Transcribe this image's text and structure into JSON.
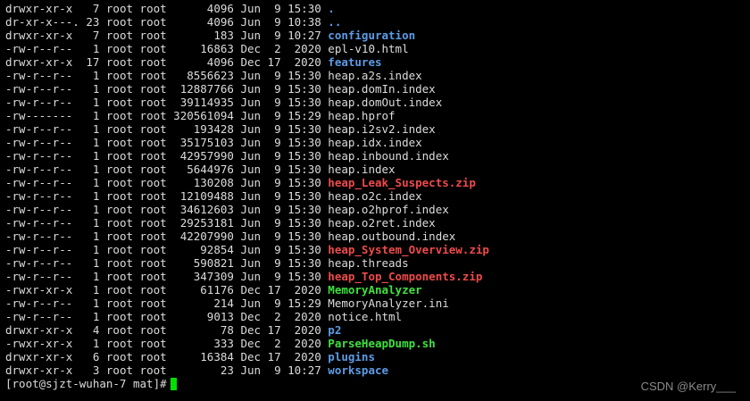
{
  "terminal": {
    "lines": [
      {
        "perms": "drwxr-xr-x",
        "links": "7",
        "owner": "root",
        "group": "root",
        "size": "4096",
        "month": "Jun",
        "day": "9",
        "time": "15:30",
        "name": ".",
        "kind": "dot"
      },
      {
        "perms": "dr-xr-x---.",
        "links": "23",
        "owner": "root",
        "group": "root",
        "size": "4096",
        "month": "Jun",
        "day": "9",
        "time": "10:38",
        "name": "..",
        "kind": "dot"
      },
      {
        "perms": "drwxr-xr-x",
        "links": "7",
        "owner": "root",
        "group": "root",
        "size": "183",
        "month": "Jun",
        "day": "9",
        "time": "10:27",
        "name": "configuration",
        "kind": "dir"
      },
      {
        "perms": "-rw-r--r--",
        "links": "1",
        "owner": "root",
        "group": "root",
        "size": "16863",
        "month": "Dec",
        "day": "2",
        "time": "2020",
        "name": "epl-v10.html",
        "kind": "plain"
      },
      {
        "perms": "drwxr-xr-x",
        "links": "17",
        "owner": "root",
        "group": "root",
        "size": "4096",
        "month": "Dec",
        "day": "17",
        "time": "2020",
        "name": "features",
        "kind": "dir"
      },
      {
        "perms": "-rw-r--r--",
        "links": "1",
        "owner": "root",
        "group": "root",
        "size": "8556623",
        "month": "Jun",
        "day": "9",
        "time": "15:30",
        "name": "heap.a2s.index",
        "kind": "plain"
      },
      {
        "perms": "-rw-r--r--",
        "links": "1",
        "owner": "root",
        "group": "root",
        "size": "12887766",
        "month": "Jun",
        "day": "9",
        "time": "15:30",
        "name": "heap.domIn.index",
        "kind": "plain"
      },
      {
        "perms": "-rw-r--r--",
        "links": "1",
        "owner": "root",
        "group": "root",
        "size": "39114935",
        "month": "Jun",
        "day": "9",
        "time": "15:30",
        "name": "heap.domOut.index",
        "kind": "plain"
      },
      {
        "perms": "-rw-------",
        "links": "1",
        "owner": "root",
        "group": "root",
        "size": "320561094",
        "month": "Jun",
        "day": "9",
        "time": "15:29",
        "name": "heap.hprof",
        "kind": "plain"
      },
      {
        "perms": "-rw-r--r--",
        "links": "1",
        "owner": "root",
        "group": "root",
        "size": "193428",
        "month": "Jun",
        "day": "9",
        "time": "15:30",
        "name": "heap.i2sv2.index",
        "kind": "plain"
      },
      {
        "perms": "-rw-r--r--",
        "links": "1",
        "owner": "root",
        "group": "root",
        "size": "35175103",
        "month": "Jun",
        "day": "9",
        "time": "15:30",
        "name": "heap.idx.index",
        "kind": "plain"
      },
      {
        "perms": "-rw-r--r--",
        "links": "1",
        "owner": "root",
        "group": "root",
        "size": "42957990",
        "month": "Jun",
        "day": "9",
        "time": "15:30",
        "name": "heap.inbound.index",
        "kind": "plain"
      },
      {
        "perms": "-rw-r--r--",
        "links": "1",
        "owner": "root",
        "group": "root",
        "size": "5644976",
        "month": "Jun",
        "day": "9",
        "time": "15:30",
        "name": "heap.index",
        "kind": "plain"
      },
      {
        "perms": "-rw-r--r--",
        "links": "1",
        "owner": "root",
        "group": "root",
        "size": "130208",
        "month": "Jun",
        "day": "9",
        "time": "15:30",
        "name": "heap_Leak_Suspects.zip",
        "kind": "archive"
      },
      {
        "perms": "-rw-r--r--",
        "links": "1",
        "owner": "root",
        "group": "root",
        "size": "12109488",
        "month": "Jun",
        "day": "9",
        "time": "15:30",
        "name": "heap.o2c.index",
        "kind": "plain"
      },
      {
        "perms": "-rw-r--r--",
        "links": "1",
        "owner": "root",
        "group": "root",
        "size": "34612603",
        "month": "Jun",
        "day": "9",
        "time": "15:30",
        "name": "heap.o2hprof.index",
        "kind": "plain"
      },
      {
        "perms": "-rw-r--r--",
        "links": "1",
        "owner": "root",
        "group": "root",
        "size": "29253181",
        "month": "Jun",
        "day": "9",
        "time": "15:30",
        "name": "heap.o2ret.index",
        "kind": "plain"
      },
      {
        "perms": "-rw-r--r--",
        "links": "1",
        "owner": "root",
        "group": "root",
        "size": "42207990",
        "month": "Jun",
        "day": "9",
        "time": "15:30",
        "name": "heap.outbound.index",
        "kind": "plain"
      },
      {
        "perms": "-rw-r--r--",
        "links": "1",
        "owner": "root",
        "group": "root",
        "size": "92854",
        "month": "Jun",
        "day": "9",
        "time": "15:30",
        "name": "heap_System_Overview.zip",
        "kind": "archive"
      },
      {
        "perms": "-rw-r--r--",
        "links": "1",
        "owner": "root",
        "group": "root",
        "size": "590821",
        "month": "Jun",
        "day": "9",
        "time": "15:30",
        "name": "heap.threads",
        "kind": "plain"
      },
      {
        "perms": "-rw-r--r--",
        "links": "1",
        "owner": "root",
        "group": "root",
        "size": "347309",
        "month": "Jun",
        "day": "9",
        "time": "15:30",
        "name": "heap_Top_Components.zip",
        "kind": "archive"
      },
      {
        "perms": "-rwxr-xr-x",
        "links": "1",
        "owner": "root",
        "group": "root",
        "size": "61176",
        "month": "Dec",
        "day": "17",
        "time": "2020",
        "name": "MemoryAnalyzer",
        "kind": "exec"
      },
      {
        "perms": "-rw-r--r--",
        "links": "1",
        "owner": "root",
        "group": "root",
        "size": "214",
        "month": "Jun",
        "day": "9",
        "time": "15:29",
        "name": "MemoryAnalyzer.ini",
        "kind": "plain"
      },
      {
        "perms": "-rw-r--r--",
        "links": "1",
        "owner": "root",
        "group": "root",
        "size": "9013",
        "month": "Dec",
        "day": "2",
        "time": "2020",
        "name": "notice.html",
        "kind": "plain"
      },
      {
        "perms": "drwxr-xr-x",
        "links": "4",
        "owner": "root",
        "group": "root",
        "size": "78",
        "month": "Dec",
        "day": "17",
        "time": "2020",
        "name": "p2",
        "kind": "dir"
      },
      {
        "perms": "-rwxr-xr-x",
        "links": "1",
        "owner": "root",
        "group": "root",
        "size": "333",
        "month": "Dec",
        "day": "2",
        "time": "2020",
        "name": "ParseHeapDump.sh",
        "kind": "exec"
      },
      {
        "perms": "drwxr-xr-x",
        "links": "6",
        "owner": "root",
        "group": "root",
        "size": "16384",
        "month": "Dec",
        "day": "17",
        "time": "2020",
        "name": "plugins",
        "kind": "dir"
      },
      {
        "perms": "drwxr-xr-x",
        "links": "3",
        "owner": "root",
        "group": "root",
        "size": "23",
        "month": "Jun",
        "day": "9",
        "time": "10:27",
        "name": "workspace",
        "kind": "dir"
      }
    ],
    "prompt": "[root@sjzt-wuhan-7 mat]#"
  },
  "watermark": "CSDN @Kerry___",
  "colors": {
    "background": "#000000",
    "text": "#dcdcdc",
    "directory": "#5c9ce6",
    "archive": "#ef4a4a",
    "executable": "#3ee23e",
    "cursor": "#00e000"
  }
}
